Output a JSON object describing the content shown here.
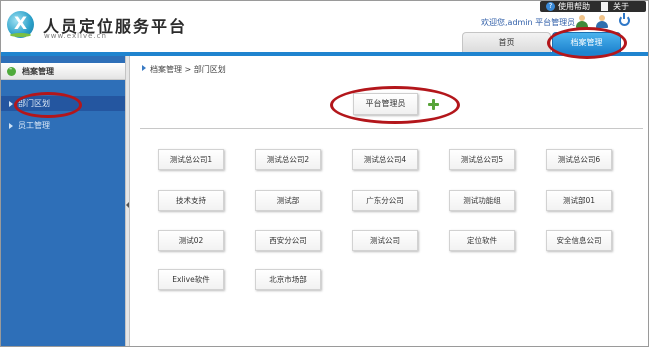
{
  "header": {
    "app_title": "人员定位服务平台",
    "app_url": "www.exlive.cn",
    "help_label": "使用帮助",
    "about_label": "关于",
    "welcome_text": "欢迎您,admin  平台管理员",
    "tabs": [
      {
        "label": "首页"
      },
      {
        "label": "档案管理"
      }
    ]
  },
  "sidebar": {
    "section_title": "档案管理",
    "items": [
      {
        "label": "部门区划"
      },
      {
        "label": "员工管理"
      }
    ]
  },
  "main": {
    "breadcrumb": "档案管理 > 部门区划",
    "company_button": "平台管理员",
    "departments": [
      "测试总公司1",
      "测试总公司2",
      "测试总公司4",
      "测试总公司5",
      "测试总公司6",
      "技术支持",
      "测试部",
      "广东分公司",
      "测试功能组",
      "测试部01",
      "测试02",
      "西安分公司",
      "测试公司",
      "定位软件",
      "安全信息公司",
      "Exlive软件",
      "北京市场部"
    ]
  },
  "colors": {
    "accent_blue": "#1f84cf",
    "sidebar_blue": "#2e6fb8",
    "annotation_red": "#b3161b",
    "add_green": "#58a43a"
  }
}
